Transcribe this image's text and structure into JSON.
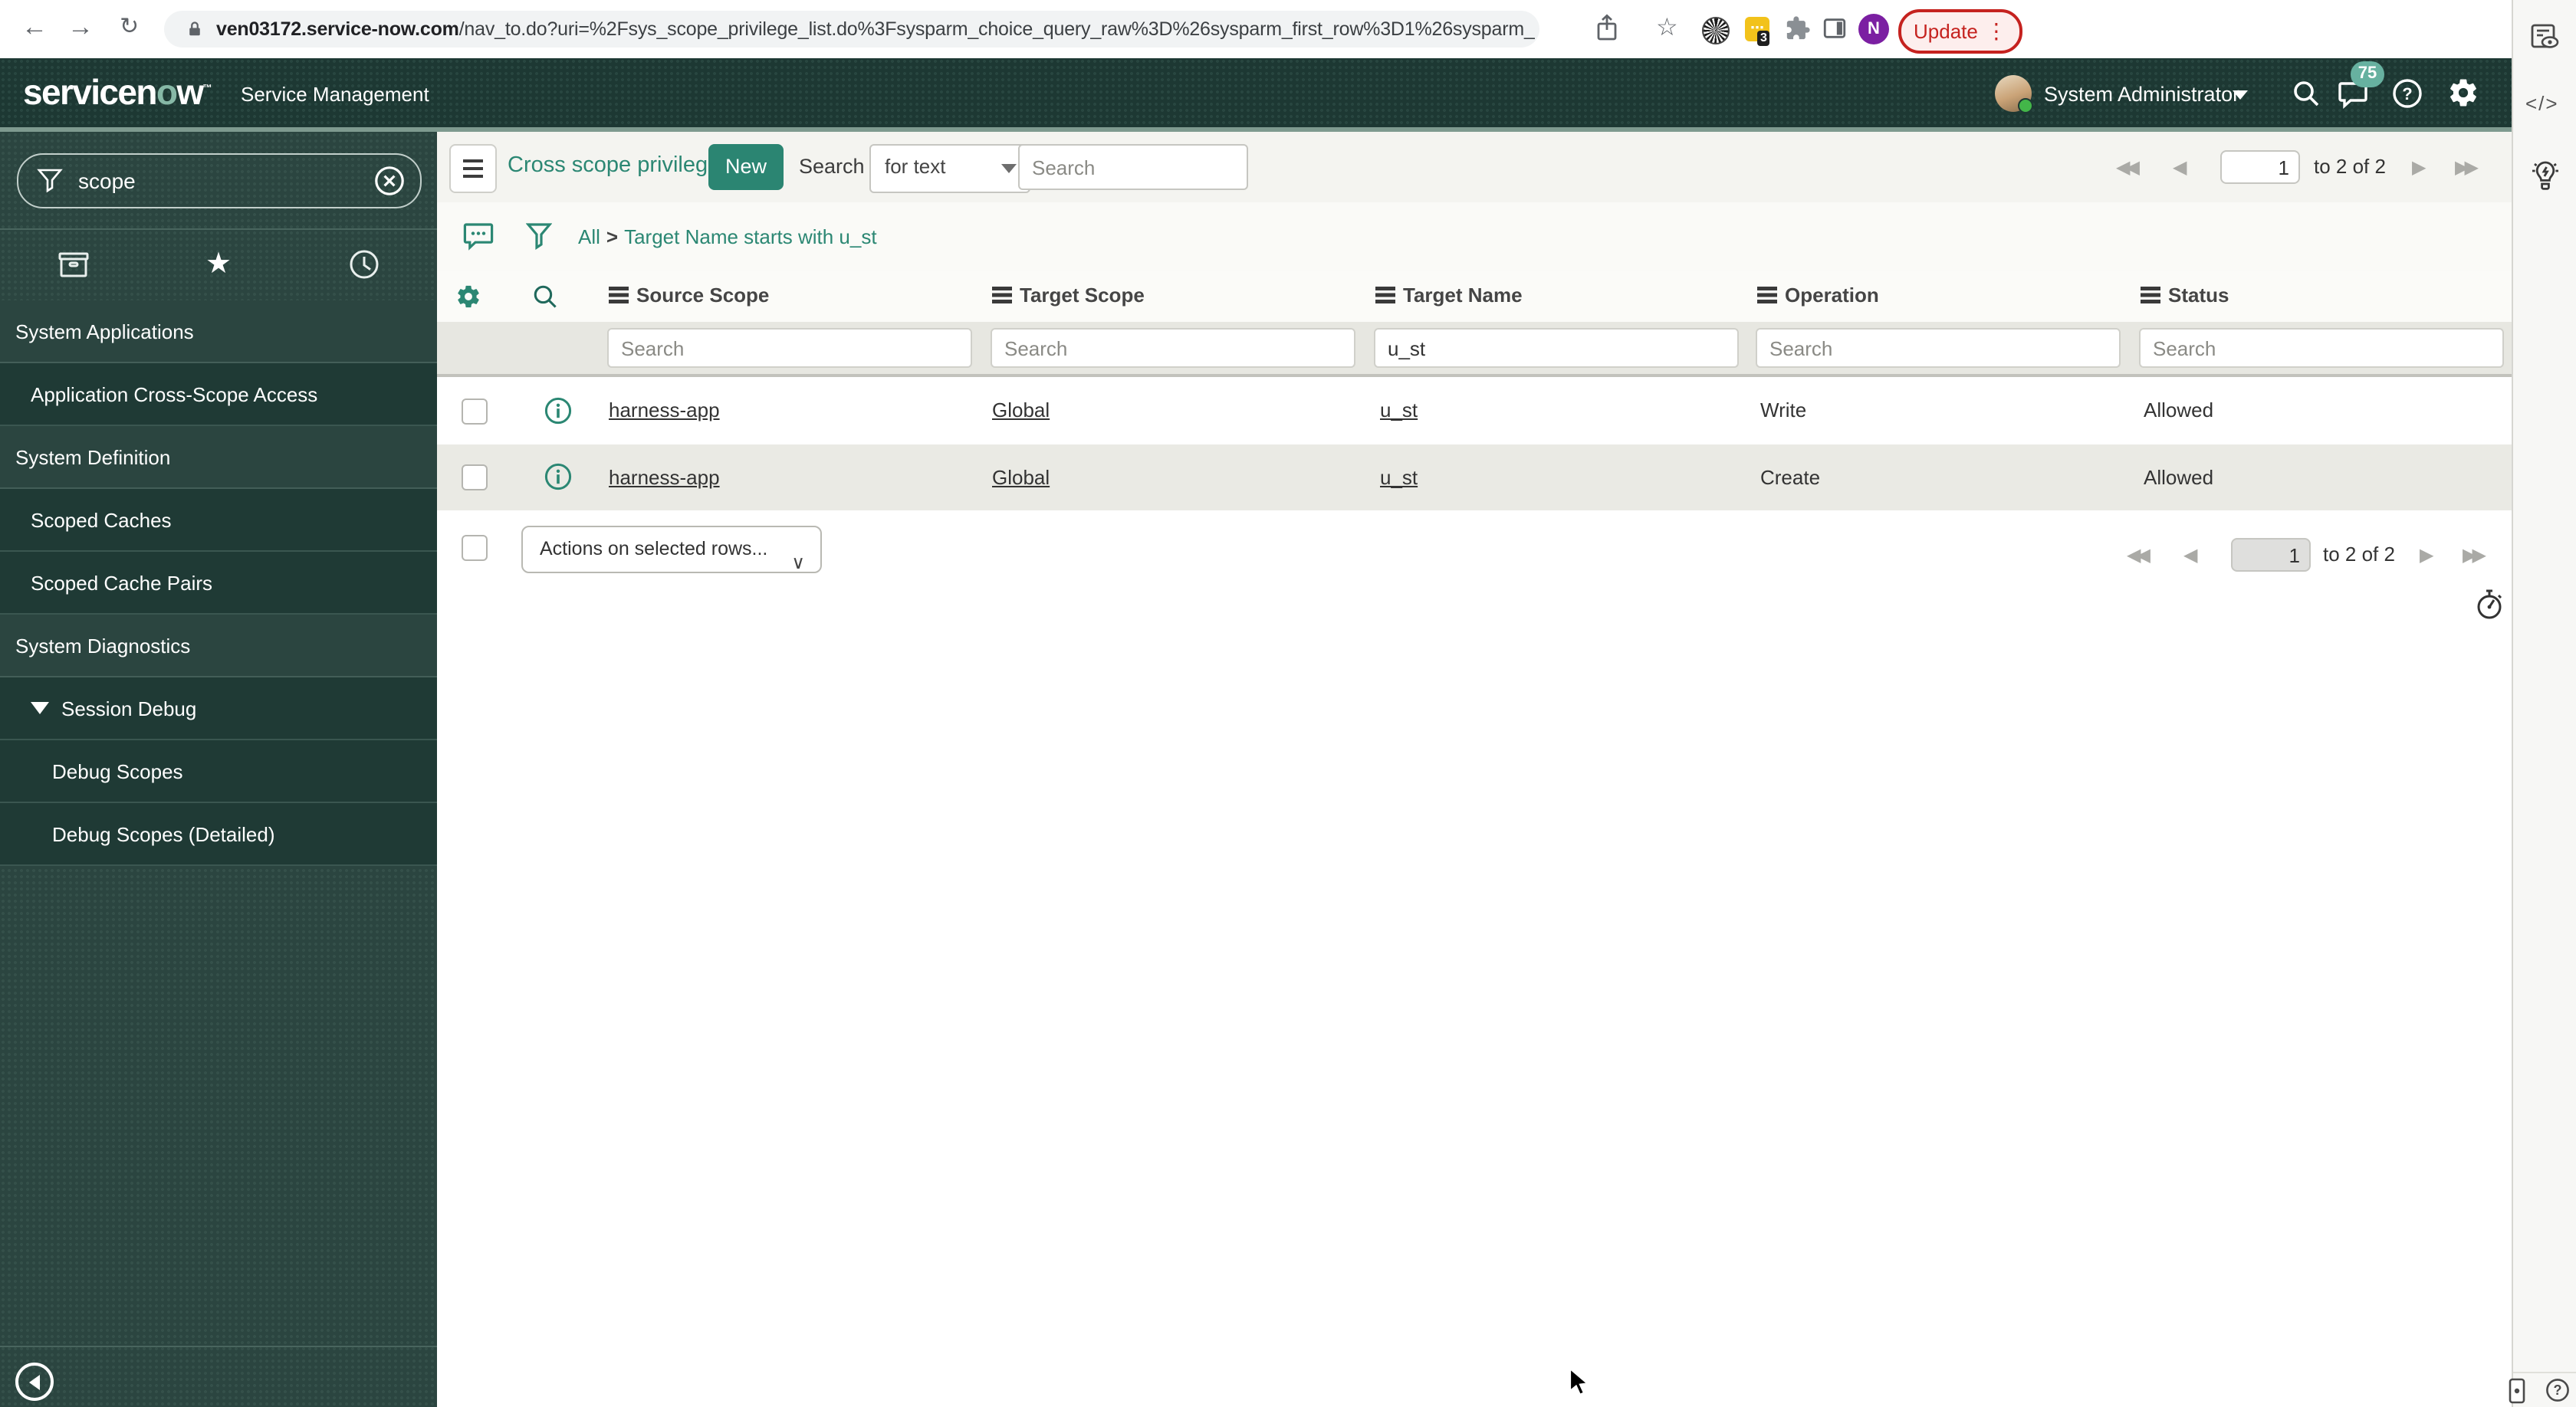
{
  "browser": {
    "back_icon": "←",
    "forward_icon": "→",
    "reload_icon": "↻",
    "url_domain": "ven03172.service-now.com",
    "url_path": "/nav_to.do?uri=%2Fsys_scope_privilege_list.do%3Fsysparm_choice_query_raw%3D%26sysparm_first_row%3D1%26sysparm_list_header_searc...",
    "extension_badge_count": "3",
    "profile_initial": "N",
    "update_label": "Update",
    "menu_icon": "⋮"
  },
  "banner": {
    "logo_pre": "servicen",
    "logo_o": "o",
    "logo_post": "w",
    "trademark": "™",
    "product_name": "Service Management",
    "user_name": "System Administrator",
    "notification_count": "75"
  },
  "sidebar": {
    "filter_value": "scope",
    "items": [
      {
        "label": "System Applications",
        "type": "section"
      },
      {
        "label": "Application Cross-Scope Access",
        "type": "item"
      },
      {
        "label": "System Definition",
        "type": "section"
      },
      {
        "label": "Scoped Caches",
        "type": "item"
      },
      {
        "label": "Scoped Cache Pairs",
        "type": "item"
      },
      {
        "label": "System Diagnostics",
        "type": "section"
      },
      {
        "label": "Session Debug",
        "type": "group"
      },
      {
        "label": "Debug Scopes",
        "type": "subitem"
      },
      {
        "label": "Debug Scopes (Detailed)",
        "type": "subitem"
      }
    ]
  },
  "list": {
    "title": "Cross scope privileges",
    "new_label": "New",
    "search_label": "Search",
    "search_mode": "for text",
    "search_placeholder": "Search",
    "breadcrumb": {
      "root": "All",
      "separator": ">",
      "condition": "Target Name starts with u_st"
    },
    "columns": [
      "Source Scope",
      "Target Scope",
      "Target Name",
      "Operation",
      "Status"
    ],
    "filter_placeholder": "Search",
    "filter_target_name_value": "u_st",
    "rows": [
      {
        "source_scope": "harness-app",
        "target_scope": "Global",
        "target_name": "u_st",
        "operation": "Write",
        "status": "Allowed"
      },
      {
        "source_scope": "harness-app",
        "target_scope": "Global",
        "target_name": "u_st",
        "operation": "Create",
        "status": "Allowed"
      }
    ],
    "actions_placeholder": "Actions on selected rows...",
    "pagination": {
      "page": "1",
      "range": "to 2 of 2",
      "first": "◀◀",
      "prev": "◀",
      "next": "▶",
      "last": "▶▶"
    }
  },
  "rail": {
    "code_icon": "</>"
  },
  "colors": {
    "banner_background": "#1d3833",
    "banner_border": "#7e9a8f",
    "accent_teal": "#2b8773",
    "sidebar_background": "#2b4540",
    "sidebar_item_background": "#1f3a35",
    "notification_badge": "#67b1a0",
    "update_button_red": "#c5221f",
    "row_alt_background": "#eaeae4",
    "profile_avatar_purple": "#7b1fa2"
  }
}
